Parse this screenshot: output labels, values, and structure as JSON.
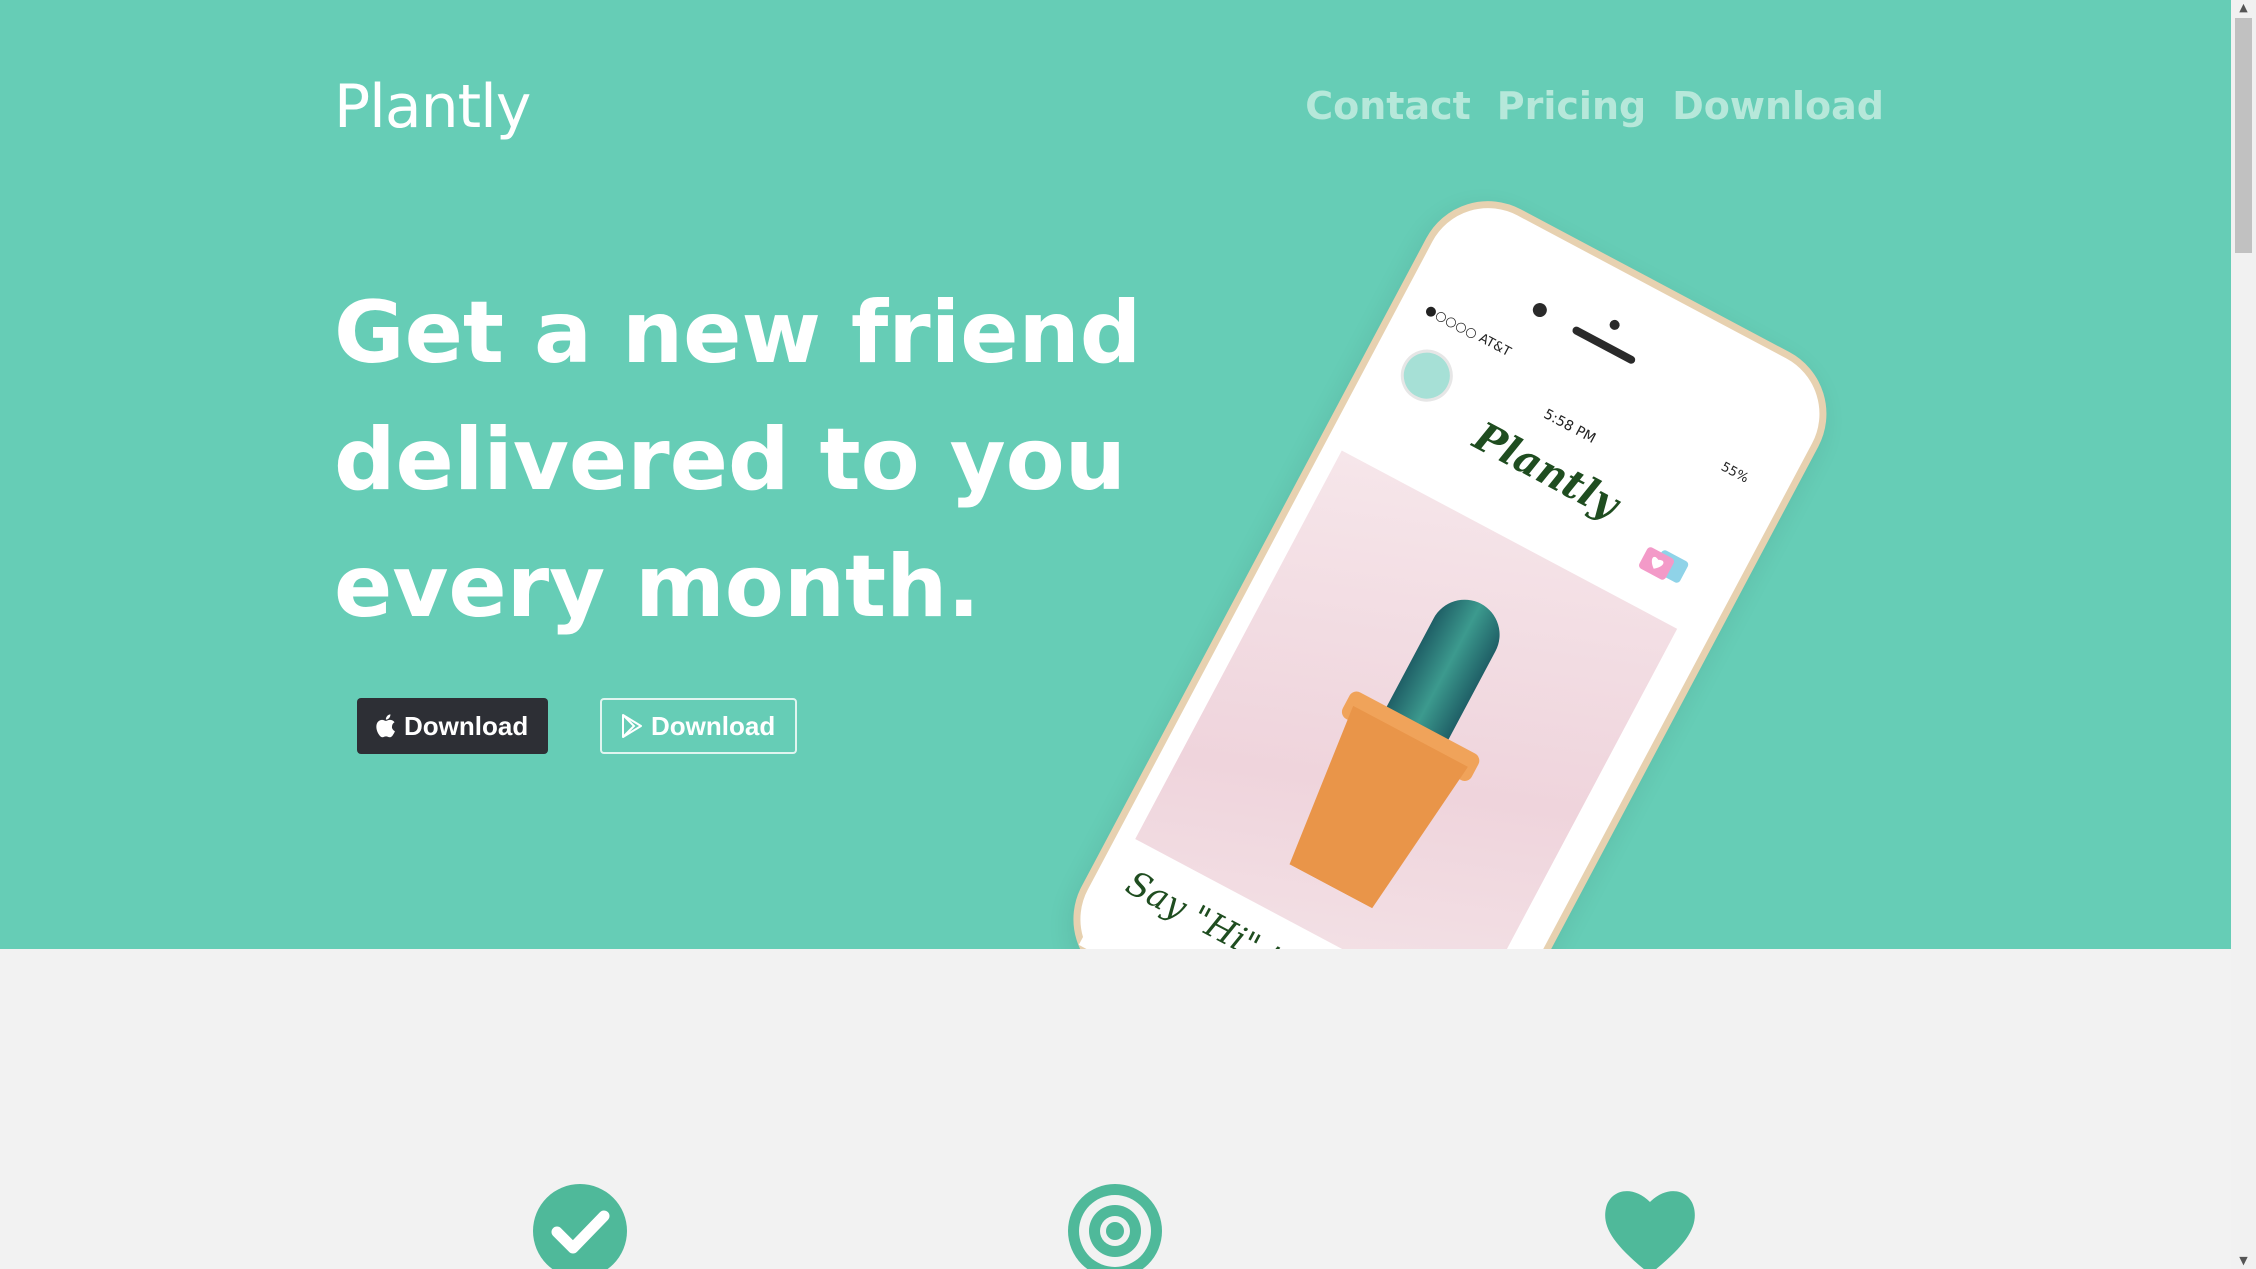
{
  "header": {
    "brand": "Plantly",
    "nav": [
      {
        "label": "Contact"
      },
      {
        "label": "Pricing"
      },
      {
        "label": "Download"
      }
    ]
  },
  "hero": {
    "headline": "Get a new friend delivered to you every month.",
    "buttons": [
      {
        "label": "Download",
        "icon": "apple-icon",
        "style": "dark"
      },
      {
        "label": "Download",
        "icon": "google-play-icon",
        "style": "outline"
      }
    ]
  },
  "phone_mockup": {
    "carrier": "●○○○○ AT&T",
    "time": "5:58 PM",
    "battery": "55%",
    "app_logo": "Plantly",
    "caption": "Say \"Hi\" to u"
  },
  "features": {
    "icons": [
      "check-circle-icon",
      "target-icon",
      "heart-icon"
    ]
  },
  "colors": {
    "primary": "#66cdb6",
    "icon_green": "#4fb99a",
    "dark_button": "#2d2f35",
    "page_bg": "#f2f2f2"
  }
}
